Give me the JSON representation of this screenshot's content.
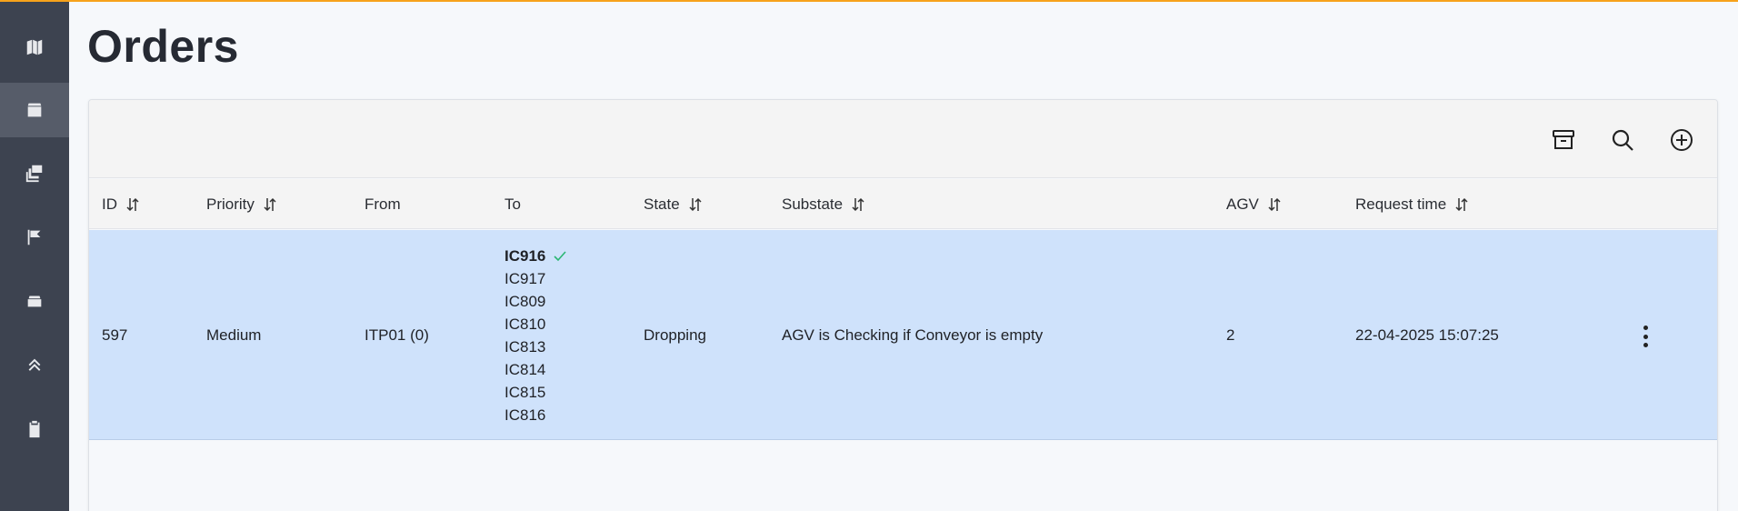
{
  "page": {
    "title": "Orders"
  },
  "sidebar": {
    "items": [
      {
        "icon": "map-icon",
        "active": false
      },
      {
        "icon": "box-icon",
        "active": true
      },
      {
        "icon": "pallet-stack-icon",
        "active": false
      },
      {
        "icon": "flag-icon",
        "active": false
      },
      {
        "icon": "container-icon",
        "active": false
      },
      {
        "icon": "chevrons-up-icon",
        "active": false
      },
      {
        "icon": "clipboard-icon",
        "active": false
      }
    ]
  },
  "toolbar": {
    "icons": [
      "archive-icon",
      "search-icon",
      "add-circle-icon"
    ]
  },
  "table": {
    "columns": [
      {
        "label": "ID",
        "sortable": true
      },
      {
        "label": "Priority",
        "sortable": true
      },
      {
        "label": "From",
        "sortable": false
      },
      {
        "label": "To",
        "sortable": false
      },
      {
        "label": "State",
        "sortable": true
      },
      {
        "label": "Substate",
        "sortable": true
      },
      {
        "label": "AGV",
        "sortable": true
      },
      {
        "label": "Request time",
        "sortable": true
      }
    ],
    "rows": [
      {
        "id": "597",
        "priority": "Medium",
        "from": "ITP01 (0)",
        "to": [
          "IC916",
          "IC917",
          "IC809",
          "IC810",
          "IC813",
          "IC814",
          "IC815",
          "IC816"
        ],
        "to_completed": "IC916",
        "state": "Dropping",
        "substate": "AGV is Checking if Conveyor is empty",
        "agv": "2",
        "request_time": "22-04-2025 15:07:25"
      }
    ]
  },
  "colors": {
    "accent": "#f7a21b",
    "sidebar": "#3d4350",
    "row_selected": "#cfe2fb",
    "check": "#2bb673"
  }
}
